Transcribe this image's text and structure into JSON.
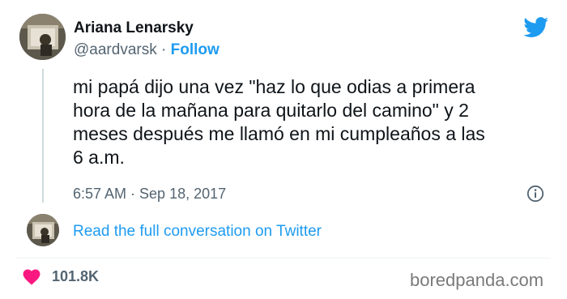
{
  "author": {
    "display_name": "Ariana Lenarsky",
    "handle": "@aardvarsk",
    "separator": "·",
    "follow_label": "Follow"
  },
  "tweet": {
    "text": "mi papá dijo una vez \"haz lo que odias a primera\nhora de la mañana para quitarlo del camino\" y 2\nmeses después me llamó en mi cumpleaños a las\n6 a.m.",
    "timestamp": "6:57 AM · Sep 18, 2017"
  },
  "conversation": {
    "link_label": "Read the full conversation on Twitter"
  },
  "engagement": {
    "likes": "101.8K"
  },
  "watermark": "boredpanda.com",
  "icons": {
    "brand": "twitter-bird-icon",
    "info": "info-icon",
    "like": "heart-icon"
  },
  "colors": {
    "accent": "#1d9bf0",
    "heart": "#f91880",
    "secondary_text": "#536471",
    "primary_text": "#0f1419"
  }
}
